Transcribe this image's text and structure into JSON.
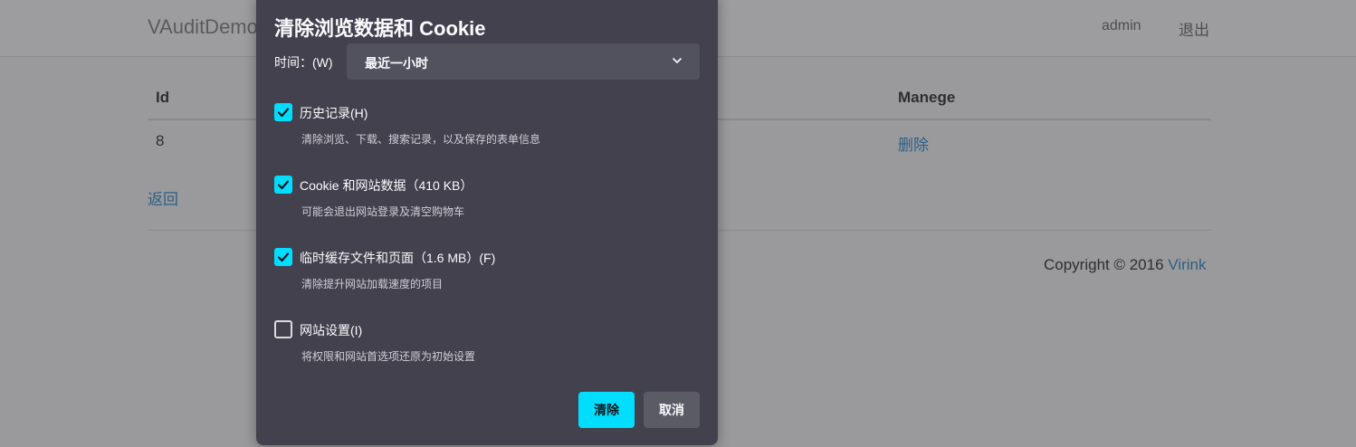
{
  "page": {
    "brand": "VAuditDemo",
    "user": "admin",
    "logout": "退出",
    "table": {
      "headers": [
        "Id",
        "Manege"
      ],
      "rows": [
        {
          "id": "8",
          "action": "删除"
        }
      ]
    },
    "back": "返回",
    "copyright_prefix": "Copyright © 2016 ",
    "copyright_link": "Virink"
  },
  "dialog": {
    "title": "清除浏览数据和 Cookie",
    "time_label": "时间：(W)",
    "time_value": "最近一小时",
    "options": [
      {
        "label": "历史记录(H)",
        "desc": "清除浏览、下载、搜索记录，以及保存的表单信息",
        "checked": true
      },
      {
        "label": "Cookie 和网站数据（410 KB）",
        "desc": "可能会退出网站登录及清空购物车",
        "checked": true
      },
      {
        "label": "临时缓存文件和页面（1.6 MB）(F)",
        "desc": "清除提升网站加载速度的项目",
        "checked": true
      },
      {
        "label": "网站设置(I)",
        "desc": "将权限和网站首选项还原为初始设置",
        "checked": false
      }
    ],
    "clear_button": "清除",
    "cancel_button": "取消"
  },
  "colors": {
    "accent": "#00ddff",
    "dialog_bg": "#42414d",
    "link": "#2d5f86"
  }
}
